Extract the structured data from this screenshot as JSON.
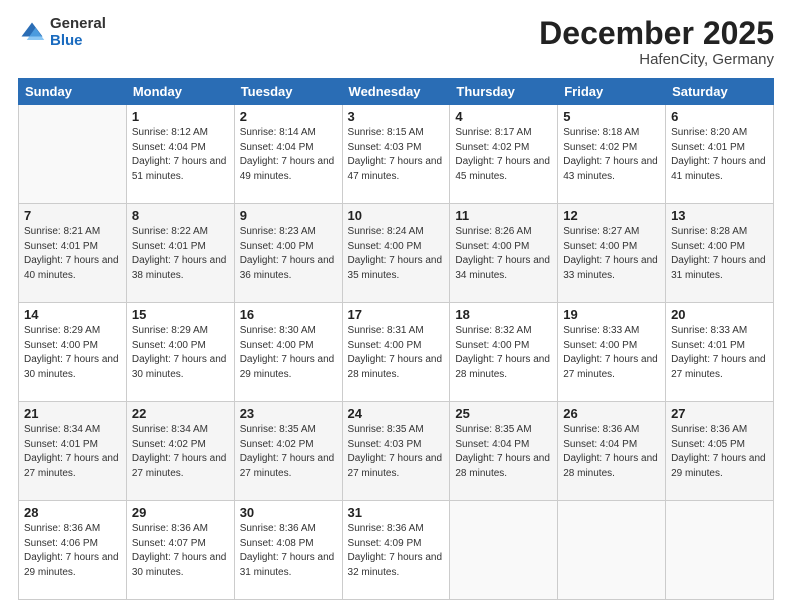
{
  "logo": {
    "general": "General",
    "blue": "Blue"
  },
  "header": {
    "month": "December 2025",
    "location": "HafenCity, Germany"
  },
  "weekdays": [
    "Sunday",
    "Monday",
    "Tuesday",
    "Wednesday",
    "Thursday",
    "Friday",
    "Saturday"
  ],
  "weeks": [
    [
      {
        "day": "",
        "sunrise": "",
        "sunset": "",
        "daylight": ""
      },
      {
        "day": "1",
        "sunrise": "Sunrise: 8:12 AM",
        "sunset": "Sunset: 4:04 PM",
        "daylight": "Daylight: 7 hours and 51 minutes."
      },
      {
        "day": "2",
        "sunrise": "Sunrise: 8:14 AM",
        "sunset": "Sunset: 4:04 PM",
        "daylight": "Daylight: 7 hours and 49 minutes."
      },
      {
        "day": "3",
        "sunrise": "Sunrise: 8:15 AM",
        "sunset": "Sunset: 4:03 PM",
        "daylight": "Daylight: 7 hours and 47 minutes."
      },
      {
        "day": "4",
        "sunrise": "Sunrise: 8:17 AM",
        "sunset": "Sunset: 4:02 PM",
        "daylight": "Daylight: 7 hours and 45 minutes."
      },
      {
        "day": "5",
        "sunrise": "Sunrise: 8:18 AM",
        "sunset": "Sunset: 4:02 PM",
        "daylight": "Daylight: 7 hours and 43 minutes."
      },
      {
        "day": "6",
        "sunrise": "Sunrise: 8:20 AM",
        "sunset": "Sunset: 4:01 PM",
        "daylight": "Daylight: 7 hours and 41 minutes."
      }
    ],
    [
      {
        "day": "7",
        "sunrise": "Sunrise: 8:21 AM",
        "sunset": "Sunset: 4:01 PM",
        "daylight": "Daylight: 7 hours and 40 minutes."
      },
      {
        "day": "8",
        "sunrise": "Sunrise: 8:22 AM",
        "sunset": "Sunset: 4:01 PM",
        "daylight": "Daylight: 7 hours and 38 minutes."
      },
      {
        "day": "9",
        "sunrise": "Sunrise: 8:23 AM",
        "sunset": "Sunset: 4:00 PM",
        "daylight": "Daylight: 7 hours and 36 minutes."
      },
      {
        "day": "10",
        "sunrise": "Sunrise: 8:24 AM",
        "sunset": "Sunset: 4:00 PM",
        "daylight": "Daylight: 7 hours and 35 minutes."
      },
      {
        "day": "11",
        "sunrise": "Sunrise: 8:26 AM",
        "sunset": "Sunset: 4:00 PM",
        "daylight": "Daylight: 7 hours and 34 minutes."
      },
      {
        "day": "12",
        "sunrise": "Sunrise: 8:27 AM",
        "sunset": "Sunset: 4:00 PM",
        "daylight": "Daylight: 7 hours and 33 minutes."
      },
      {
        "day": "13",
        "sunrise": "Sunrise: 8:28 AM",
        "sunset": "Sunset: 4:00 PM",
        "daylight": "Daylight: 7 hours and 31 minutes."
      }
    ],
    [
      {
        "day": "14",
        "sunrise": "Sunrise: 8:29 AM",
        "sunset": "Sunset: 4:00 PM",
        "daylight": "Daylight: 7 hours and 30 minutes."
      },
      {
        "day": "15",
        "sunrise": "Sunrise: 8:29 AM",
        "sunset": "Sunset: 4:00 PM",
        "daylight": "Daylight: 7 hours and 30 minutes."
      },
      {
        "day": "16",
        "sunrise": "Sunrise: 8:30 AM",
        "sunset": "Sunset: 4:00 PM",
        "daylight": "Daylight: 7 hours and 29 minutes."
      },
      {
        "day": "17",
        "sunrise": "Sunrise: 8:31 AM",
        "sunset": "Sunset: 4:00 PM",
        "daylight": "Daylight: 7 hours and 28 minutes."
      },
      {
        "day": "18",
        "sunrise": "Sunrise: 8:32 AM",
        "sunset": "Sunset: 4:00 PM",
        "daylight": "Daylight: 7 hours and 28 minutes."
      },
      {
        "day": "19",
        "sunrise": "Sunrise: 8:33 AM",
        "sunset": "Sunset: 4:00 PM",
        "daylight": "Daylight: 7 hours and 27 minutes."
      },
      {
        "day": "20",
        "sunrise": "Sunrise: 8:33 AM",
        "sunset": "Sunset: 4:01 PM",
        "daylight": "Daylight: 7 hours and 27 minutes."
      }
    ],
    [
      {
        "day": "21",
        "sunrise": "Sunrise: 8:34 AM",
        "sunset": "Sunset: 4:01 PM",
        "daylight": "Daylight: 7 hours and 27 minutes."
      },
      {
        "day": "22",
        "sunrise": "Sunrise: 8:34 AM",
        "sunset": "Sunset: 4:02 PM",
        "daylight": "Daylight: 7 hours and 27 minutes."
      },
      {
        "day": "23",
        "sunrise": "Sunrise: 8:35 AM",
        "sunset": "Sunset: 4:02 PM",
        "daylight": "Daylight: 7 hours and 27 minutes."
      },
      {
        "day": "24",
        "sunrise": "Sunrise: 8:35 AM",
        "sunset": "Sunset: 4:03 PM",
        "daylight": "Daylight: 7 hours and 27 minutes."
      },
      {
        "day": "25",
        "sunrise": "Sunrise: 8:35 AM",
        "sunset": "Sunset: 4:04 PM",
        "daylight": "Daylight: 7 hours and 28 minutes."
      },
      {
        "day": "26",
        "sunrise": "Sunrise: 8:36 AM",
        "sunset": "Sunset: 4:04 PM",
        "daylight": "Daylight: 7 hours and 28 minutes."
      },
      {
        "day": "27",
        "sunrise": "Sunrise: 8:36 AM",
        "sunset": "Sunset: 4:05 PM",
        "daylight": "Daylight: 7 hours and 29 minutes."
      }
    ],
    [
      {
        "day": "28",
        "sunrise": "Sunrise: 8:36 AM",
        "sunset": "Sunset: 4:06 PM",
        "daylight": "Daylight: 7 hours and 29 minutes."
      },
      {
        "day": "29",
        "sunrise": "Sunrise: 8:36 AM",
        "sunset": "Sunset: 4:07 PM",
        "daylight": "Daylight: 7 hours and 30 minutes."
      },
      {
        "day": "30",
        "sunrise": "Sunrise: 8:36 AM",
        "sunset": "Sunset: 4:08 PM",
        "daylight": "Daylight: 7 hours and 31 minutes."
      },
      {
        "day": "31",
        "sunrise": "Sunrise: 8:36 AM",
        "sunset": "Sunset: 4:09 PM",
        "daylight": "Daylight: 7 hours and 32 minutes."
      },
      {
        "day": "",
        "sunrise": "",
        "sunset": "",
        "daylight": ""
      },
      {
        "day": "",
        "sunrise": "",
        "sunset": "",
        "daylight": ""
      },
      {
        "day": "",
        "sunrise": "",
        "sunset": "",
        "daylight": ""
      }
    ]
  ]
}
